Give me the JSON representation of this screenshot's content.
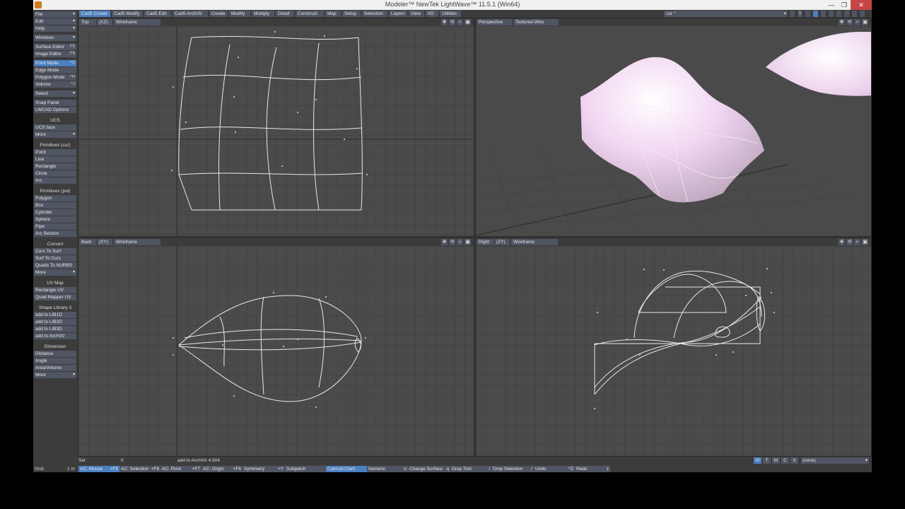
{
  "window": {
    "title": "Modeler™ NewTek LightWave™ 11.5.1 (Win64)",
    "minimize": "—",
    "maximize": "❐",
    "close": "✕"
  },
  "sidebar": {
    "items": [
      {
        "label": "File",
        "dd": true
      },
      {
        "label": "Edit",
        "dd": true
      },
      {
        "label": "Help",
        "dd": true
      },
      {
        "label": "Windows",
        "dd": true
      },
      {
        "label": "Surface Editor",
        "shortcut": "F5"
      },
      {
        "label": "Image Editor",
        "shortcut": "F6"
      },
      {
        "label": "Point Mode",
        "shortcut": "^G",
        "active": true
      },
      {
        "label": "Edge Mode"
      },
      {
        "label": "Polygon Mode",
        "shortcut": "^H"
      },
      {
        "label": "Volume",
        "shortcut": "^J"
      },
      {
        "label": "Select",
        "dd": true
      },
      {
        "label": "Snap Panel"
      },
      {
        "label": "LWCAD Options"
      }
    ],
    "ucs_header": "UCS",
    "ucs_items": [
      {
        "label": "UCS face"
      },
      {
        "label": "More",
        "dd": true
      }
    ],
    "prim_cur_header": "Primitives (cur)",
    "prim_cur": [
      {
        "label": "Point"
      },
      {
        "label": "Line"
      },
      {
        "label": "Rectangle"
      },
      {
        "label": "Circle"
      },
      {
        "label": "Arc"
      }
    ],
    "prim_pol_header": "Primitives (pol)",
    "prim_pol": [
      {
        "label": "Polygon"
      },
      {
        "label": "Box"
      },
      {
        "label": "Cylinder"
      },
      {
        "label": "Sphere"
      },
      {
        "label": "Pipe"
      },
      {
        "label": "Arc Section"
      }
    ],
    "convert_header": "Convert",
    "convert": [
      {
        "label": "Curs To Surf"
      },
      {
        "label": "Surf To Curs"
      },
      {
        "label": "Quads To NURBS"
      },
      {
        "label": "More",
        "dd": true
      }
    ],
    "uvmap_header": "UV Map",
    "uvmap": [
      {
        "label": "Rectangle UV"
      },
      {
        "label": "Quad Mapper UV"
      }
    ],
    "shape_header": "Shape Library 3",
    "shape": [
      {
        "label": "add to LIB1D"
      },
      {
        "label": "add to LIB2D"
      },
      {
        "label": "add to LIB3D"
      },
      {
        "label": "add to ArchViz"
      }
    ],
    "dimension_header": "Dimension",
    "dimension": [
      {
        "label": "Distance"
      },
      {
        "label": "Angle"
      },
      {
        "label": "Area/Volume"
      },
      {
        "label": "More",
        "dd": true
      }
    ]
  },
  "tabs": [
    "Cad5 Create",
    "Cad5 Modify",
    "Cad5 Edit",
    "Cad5 ArchViz",
    "Create",
    "Modify",
    "Multiply",
    "Detail",
    "Construct",
    "Map",
    "Setup",
    "Selection",
    "Layers",
    "View",
    "I/O",
    "Utilities"
  ],
  "active_tab": "Cad5 Create",
  "object_selector": "car *",
  "layer_number": "1",
  "viewports": {
    "top": {
      "view": "Top",
      "axis": "(XZ)",
      "mode": "Wireframe"
    },
    "perspective": {
      "view": "Perspective",
      "mode": "Textured Wire"
    },
    "back": {
      "view": "Back",
      "axis": "(XY)",
      "mode": "Wireframe"
    },
    "right": {
      "view": "Right",
      "axis": "(ZY)",
      "mode": "Wireframe"
    }
  },
  "status": {
    "sel_label": "Sel:",
    "sel_value": "0",
    "message": "add to ArchViz 4.904",
    "grid_label": "Grid:",
    "grid_value": "1 m",
    "buttons": [
      {
        "label": "AC: Mouse",
        "shortcut": "+F5",
        "active": true
      },
      {
        "label": "AC: Selection",
        "shortcut": "+F8"
      },
      {
        "label": "AC: Pivot",
        "shortcut": "+F7"
      },
      {
        "label": "AC: Origin",
        "shortcut": "+F6"
      },
      {
        "label": "Symmetry",
        "shortcut": "+Y"
      },
      {
        "label": "Subpatch"
      },
      {
        "label": "Catmull-Clark",
        "active": true
      },
      {
        "label": "Numeric",
        "shortcut": "n"
      },
      {
        "label": "Change Surface",
        "shortcut": "q"
      },
      {
        "label": "Drop Tool",
        "shortcut": "/"
      },
      {
        "label": "Drop Selection",
        "shortcut": "/"
      },
      {
        "label": "Undo",
        "shortcut": "^Z"
      },
      {
        "label": "Redo",
        "shortcut": "z"
      }
    ],
    "wtmcs": [
      "W",
      "T",
      "M",
      "C",
      "S"
    ],
    "surface_select": "(none)"
  },
  "colors": {
    "accent": "#4a7fc0",
    "button": "#505563",
    "panel": "#3c3c3c",
    "viewport": "#4b4b4b",
    "surface": "#f4d8f4"
  }
}
